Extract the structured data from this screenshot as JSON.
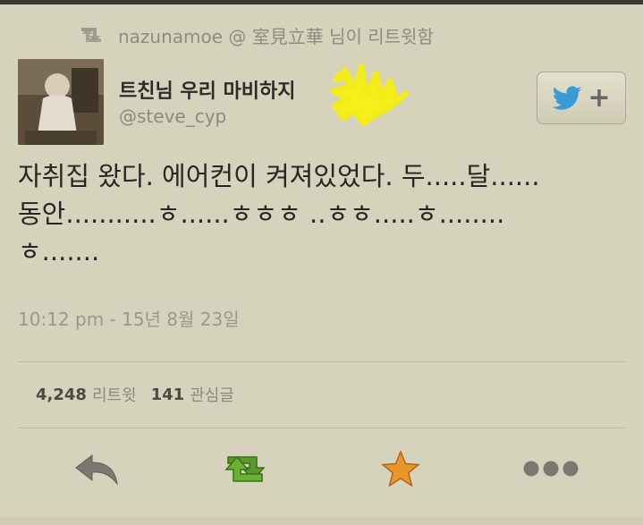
{
  "retweet_notice": {
    "text": "nazunamoe @ 室見立華 님이 리트윗함",
    "icon": "retweet-icon"
  },
  "tweet": {
    "author_name": "트친님 우리 마비하지",
    "author_handle": "@steve_cyp",
    "text": "자취집 왔다. 에어컨이 켜져있었다. 두.....달......\n동안...........ㅎ......ㅎㅎㅎ ..ㅎㅎ.....ㅎ........\nㅎ.......",
    "timestamp": "10:12 pm - 15년 8월 23일"
  },
  "stats": {
    "retweets_count": "4,248",
    "retweets_label": "리트윗",
    "likes_count": "141",
    "likes_label": "관심글"
  },
  "follow_button": {
    "icon": "twitter-bird-icon",
    "plus": "+"
  },
  "actions": [
    {
      "name": "reply",
      "icon": "reply-icon"
    },
    {
      "name": "retweet",
      "icon": "retweet-icon"
    },
    {
      "name": "favorite",
      "icon": "star-icon"
    },
    {
      "name": "more",
      "icon": "more-icon"
    }
  ],
  "colors": {
    "background": "#d6d3bd",
    "retweet_green": "#5a9a2a",
    "star_orange": "#e8952a",
    "twitter_blue": "#3a9ad6"
  }
}
